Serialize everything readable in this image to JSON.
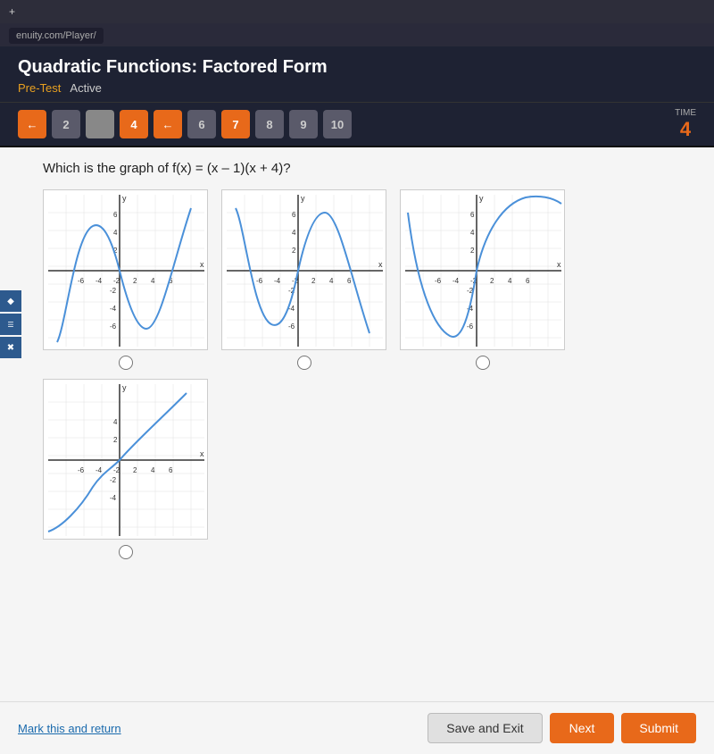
{
  "browser": {
    "tab_label": "+",
    "address": "enuity.com/Player/"
  },
  "header": {
    "title": "Quadratic Functions: Factored Form",
    "pre_test_label": "Pre-Test",
    "status_label": "Active"
  },
  "nav": {
    "buttons": [
      {
        "id": 1,
        "label": "←",
        "type": "orange"
      },
      {
        "id": 2,
        "label": "2",
        "type": "gray"
      },
      {
        "id": 3,
        "label": "",
        "type": "gray"
      },
      {
        "id": 4,
        "label": "4",
        "type": "orange"
      },
      {
        "id": 5,
        "label": "←",
        "type": "orange"
      },
      {
        "id": 6,
        "label": "6",
        "type": "gray"
      },
      {
        "id": 7,
        "label": "7",
        "type": "current"
      },
      {
        "id": 8,
        "label": "8",
        "type": "gray"
      },
      {
        "id": 9,
        "label": "9",
        "type": "gray"
      },
      {
        "id": 10,
        "label": "10",
        "type": "gray"
      }
    ],
    "time_label": "TIME",
    "time_value": "4"
  },
  "question": {
    "text": "Which is the graph of f(x) = (x – 1)(x + 4)?"
  },
  "graphs": [
    {
      "id": "A",
      "selected": false
    },
    {
      "id": "B",
      "selected": false
    },
    {
      "id": "C",
      "selected": false
    },
    {
      "id": "D",
      "selected": false
    }
  ],
  "footer": {
    "mark_return": "Mark this and return",
    "save_exit": "Save and Exit",
    "next": "Next",
    "submit": "Submit"
  }
}
